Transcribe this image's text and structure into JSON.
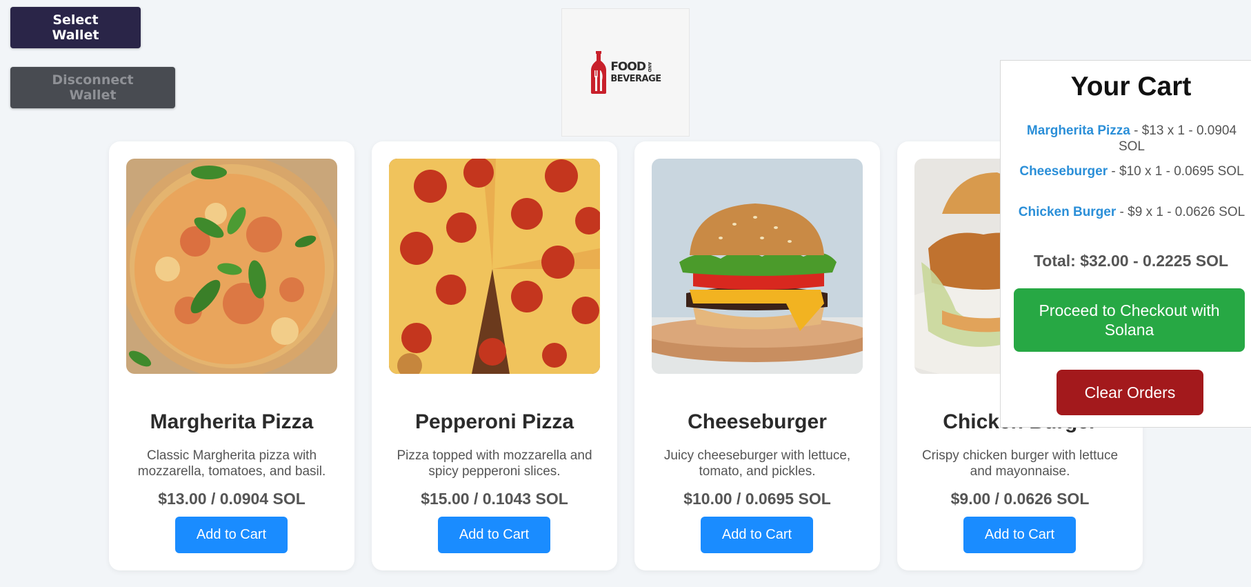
{
  "wallet": {
    "select_label": "Select Wallet",
    "disconnect_label": "Disconnect Wallet"
  },
  "logo": {
    "text_line1": "FOOD",
    "text_and": "AND",
    "text_line2": "BEVERAGE",
    "brand_color": "#c8202b"
  },
  "products": [
    {
      "name": "Margherita Pizza",
      "description": "Classic Margherita pizza with mozzarella, tomatoes, and basil.",
      "price": "$13.00 / 0.0904 SOL",
      "button": "Add to Cart",
      "image_icon": "margherita-pizza-photo"
    },
    {
      "name": "Pepperoni Pizza",
      "description": "Pizza topped with mozzarella and spicy pepperoni slices.",
      "price": "$15.00 / 0.1043 SOL",
      "button": "Add to Cart",
      "image_icon": "pepperoni-pizza-photo"
    },
    {
      "name": "Cheeseburger",
      "description": "Juicy cheeseburger with lettuce, tomato, and pickles.",
      "price": "$10.00 / 0.0695 SOL",
      "button": "Add to Cart",
      "image_icon": "cheeseburger-photo"
    },
    {
      "name": "Chicken Burger",
      "description": "Crispy chicken burger with lettuce and mayonnaise.",
      "price": "$9.00 / 0.0626 SOL",
      "button": "Add to Cart",
      "image_icon": "chicken-burger-photo"
    }
  ],
  "cart": {
    "title": "Your Cart",
    "items": [
      {
        "name": "Margherita Pizza",
        "detail": " - $13 x 1 - 0.0904 SOL"
      },
      {
        "name": "Cheeseburger",
        "detail": " - $10 x 1 - 0.0695 SOL"
      },
      {
        "name": "Chicken Burger",
        "detail": " - $9 x 1 - 0.0626 SOL"
      }
    ],
    "total": "Total: $32.00 - 0.2225 SOL",
    "checkout_label": "Proceed to Checkout with Solana",
    "clear_label": "Clear Orders"
  },
  "colors": {
    "primary_button": "#1a8cff",
    "checkout_button": "#27a844",
    "clear_button": "#a3191c",
    "wallet_button": "#2a2548",
    "cart_item_link": "#2b8fd8"
  }
}
